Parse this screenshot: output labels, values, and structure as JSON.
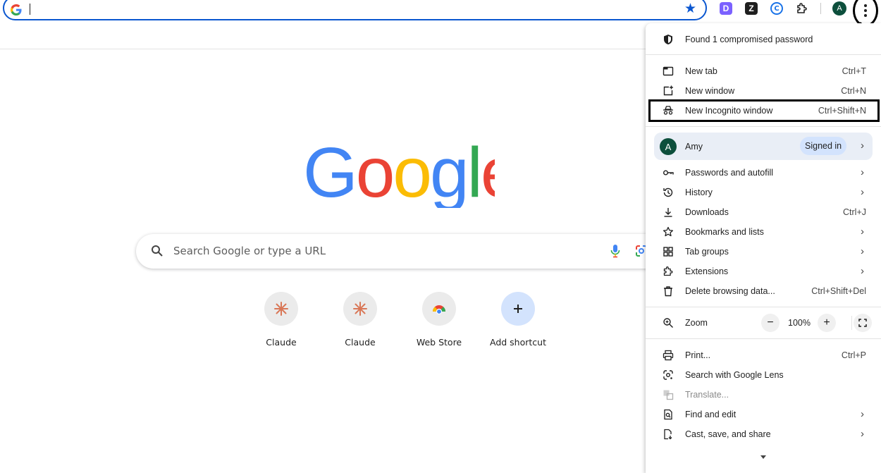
{
  "toolbar": {
    "omnibox_value": "",
    "extensions": [
      {
        "name": "d-extension-icon",
        "glyph": "D"
      },
      {
        "name": "z-extension-icon",
        "glyph": "Z"
      },
      {
        "name": "c-extension-icon",
        "glyph": "C"
      }
    ],
    "avatar_initial": "A"
  },
  "ntp": {
    "logo_text": "Google",
    "logo_colors": [
      "#4285f4",
      "#ea4335",
      "#fbbc05",
      "#4285f4",
      "#34a853",
      "#ea4335"
    ],
    "search_placeholder": "Search Google or type a URL",
    "shortcuts": [
      {
        "label": "Claude",
        "icon": "claude-icon"
      },
      {
        "label": "Claude",
        "icon": "claude-icon"
      },
      {
        "label": "Web Store",
        "icon": "web-store-icon"
      },
      {
        "label": "Add shortcut",
        "icon": "plus-icon"
      }
    ]
  },
  "menu": {
    "alert": "Found 1 compromised password",
    "new_tab": {
      "label": "New tab",
      "shortcut": "Ctrl+T"
    },
    "new_window": {
      "label": "New window",
      "shortcut": "Ctrl+N"
    },
    "incognito": {
      "label": "New Incognito window",
      "shortcut": "Ctrl+Shift+N"
    },
    "profile": {
      "initial": "A",
      "name": "Amy",
      "badge": "Signed in"
    },
    "passwords": {
      "label": "Passwords and autofill"
    },
    "history": {
      "label": "History"
    },
    "downloads": {
      "label": "Downloads",
      "shortcut": "Ctrl+J"
    },
    "bookmarks": {
      "label": "Bookmarks and lists"
    },
    "tab_groups": {
      "label": "Tab groups"
    },
    "extensions": {
      "label": "Extensions"
    },
    "delete_data": {
      "label": "Delete browsing data...",
      "shortcut": "Ctrl+Shift+Del"
    },
    "zoom": {
      "label": "Zoom",
      "minus": "−",
      "value": "100%",
      "plus": "+"
    },
    "print": {
      "label": "Print...",
      "shortcut": "Ctrl+P"
    },
    "lens": {
      "label": "Search with Google Lens"
    },
    "translate": {
      "label": "Translate..."
    },
    "find_edit": {
      "label": "Find and edit"
    },
    "cast": {
      "label": "Cast, save, and share"
    }
  },
  "colors": {
    "accent": "#0b57d0",
    "profile_bg": "#e9eef6",
    "badge_bg": "#d3e3fd",
    "avatar": "#0d4f3c"
  }
}
